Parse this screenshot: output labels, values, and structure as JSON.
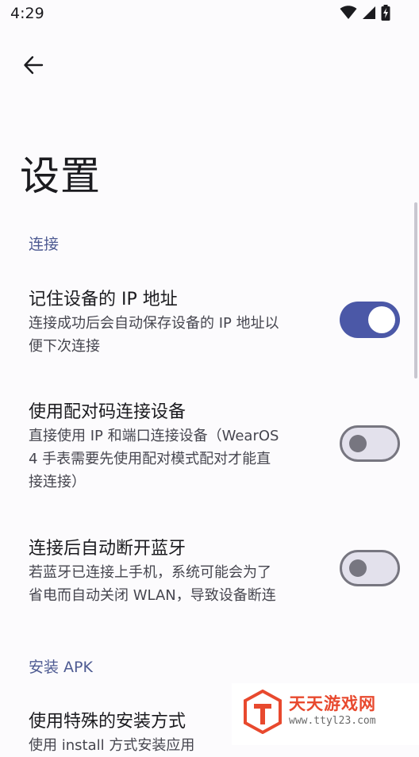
{
  "status_bar": {
    "time": "4:29",
    "icons": [
      "wifi-icon",
      "signal-icon",
      "battery-charging-icon"
    ]
  },
  "header": {
    "back_icon": "arrow-back-icon"
  },
  "page": {
    "title": "设置"
  },
  "sections": [
    {
      "header": "连接",
      "items": [
        {
          "title": "记住设备的 IP 地址",
          "summary": "连接成功后会自动保存设备的 IP 地址以\n便下次连接",
          "switch_on": true
        },
        {
          "title": "使用配对码连接设备",
          "summary": "直接使用 IP 和端口连接设备（WearOS\n4 手表需要先使用配对模式配对才能直\n接连接）",
          "switch_on": false
        },
        {
          "title": "连接后自动断开蓝牙",
          "summary": "若蓝牙已连接上手机，系统可能会为了\n省电而自动关闭 WLAN，导致设备断连",
          "switch_on": false
        }
      ]
    },
    {
      "header": "安装 APK",
      "items": [
        {
          "title": "使用特殊的安装方式",
          "summary": "使用 install 方式安装应用"
        }
      ]
    }
  ],
  "watermark": {
    "name": "天天游戏网",
    "url": "www.ttyl23.com"
  },
  "colors": {
    "accent": "#4B58A7",
    "section_header": "#4E5B92",
    "background": "#FCFBFD",
    "watermark": "#E8492E"
  }
}
